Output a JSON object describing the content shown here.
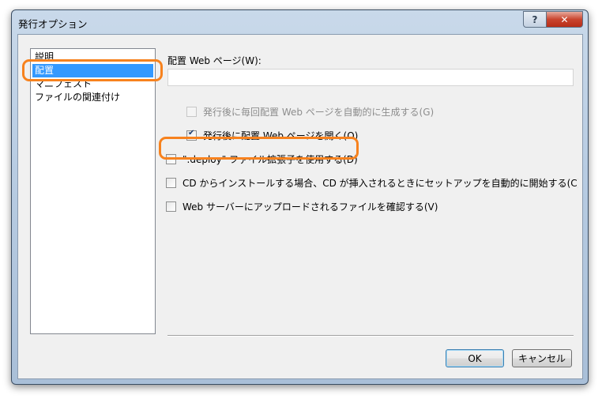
{
  "window": {
    "title": "発行オプション",
    "help_label": "?",
    "close_label": "✕"
  },
  "nav": {
    "items": [
      {
        "label": "説明"
      },
      {
        "label": "配置"
      },
      {
        "label": "マニフェスト"
      },
      {
        "label": "ファイルの関連付け"
      }
    ],
    "selected_index": 1
  },
  "deploy": {
    "web_page_label": "配置 Web ページ(W):",
    "web_page_value": "",
    "options": [
      {
        "label": "発行後に毎回配置 Web ページを自動的に生成する(G)",
        "checked": false,
        "enabled": false
      },
      {
        "label": "発行後に配置 Web ページを開く(O)",
        "checked": true,
        "enabled": true
      },
      {
        "label": "\".deploy\" ファイル拡張子を使用する(D)",
        "checked": false,
        "enabled": true
      },
      {
        "label": "CD からインストールする場合、CD が挿入されるときにセットアップを自動的に開始する(C)",
        "checked": false,
        "enabled": true
      },
      {
        "label": "Web サーバーにアップロードされるファイルを確認する(V)",
        "checked": false,
        "enabled": true
      }
    ]
  },
  "buttons": {
    "ok_label": "OK",
    "cancel_label": "キャンセル"
  },
  "colors": {
    "highlight": "#f7821e",
    "selection": "#3399ff"
  }
}
